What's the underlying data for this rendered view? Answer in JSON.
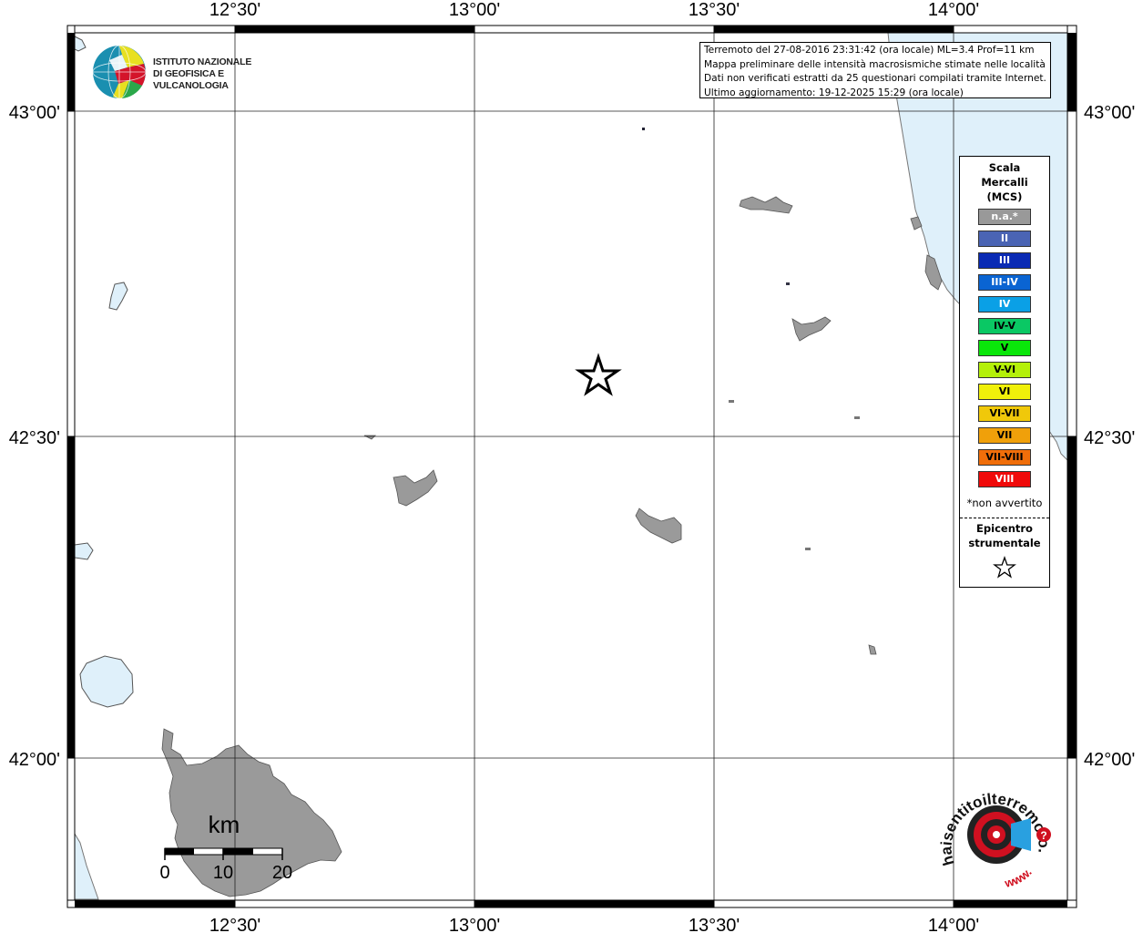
{
  "coord_labels": {
    "lon": [
      "12°30'",
      "13°00'",
      "13°30'",
      "14°00'"
    ],
    "lat": [
      "43°00'",
      "42°30'",
      "42°00'"
    ]
  },
  "info": {
    "line1": "Terremoto del 27-08-2016 23:31:42 (ora locale) ML=3.4 Prof=11 km",
    "line2": "Mappa preliminare delle intensità macrosismiche stimate nelle località",
    "line3": "Dati non verificati estratti da 25 questionari compilati tramite Internet.",
    "line4": "Ultimo aggiornamento: 19-12-2025 15:29 (ora locale)"
  },
  "logo": {
    "line1": "ISTITUTO NAZIONALE",
    "line2": "DI GEOFISICA E VULCANOLOGIA"
  },
  "legend": {
    "title_line1": "Scala",
    "title_line2": "Mercalli",
    "title_line3": "(MCS)",
    "items": [
      {
        "label": "n.a.*",
        "color": "#999999",
        "text_color": "#ffffff"
      },
      {
        "label": "II",
        "color": "#4a64b4",
        "text_color": "#ffffff"
      },
      {
        "label": "III",
        "color": "#0a2ab4",
        "text_color": "#ffffff"
      },
      {
        "label": "III-IV",
        "color": "#0a64d2",
        "text_color": "#ffffff"
      },
      {
        "label": "IV",
        "color": "#0aa0e6",
        "text_color": "#ffffff"
      },
      {
        "label": "IV-V",
        "color": "#0ac864",
        "text_color": "#000000"
      },
      {
        "label": "V",
        "color": "#0ae60a",
        "text_color": "#000000"
      },
      {
        "label": "V-VI",
        "color": "#b4f00a",
        "text_color": "#000000"
      },
      {
        "label": "VI",
        "color": "#f0f00a",
        "text_color": "#000000"
      },
      {
        "label": "VI-VII",
        "color": "#f0c80a",
        "text_color": "#000000"
      },
      {
        "label": "VII",
        "color": "#f0a00a",
        "text_color": "#000000"
      },
      {
        "label": "VII-VIII",
        "color": "#f06e0a",
        "text_color": "#000000"
      },
      {
        "label": "VIII",
        "color": "#f00a0a",
        "text_color": "#ffffff"
      }
    ],
    "note": "*non avvertito",
    "epicenter_line1": "Epicentro",
    "epicenter_line2": "strumentale"
  },
  "scale_bar": {
    "unit": "km",
    "ticks": [
      "0",
      "10",
      "20"
    ]
  },
  "hsit_logo": {
    "text": "haisentitoilterremoto.it",
    "url_text": "www."
  },
  "colors": {
    "sea": "#dff0fa",
    "urban": "#9a9a9a",
    "frame": "#000000"
  }
}
